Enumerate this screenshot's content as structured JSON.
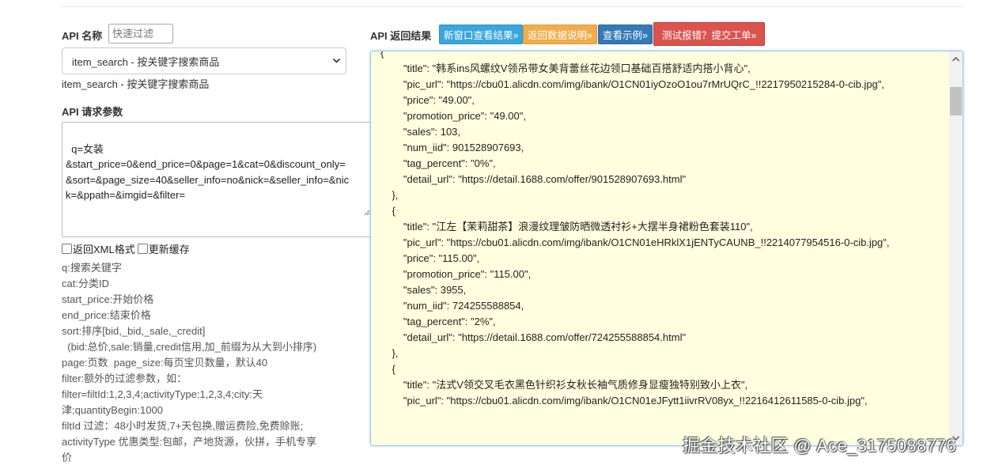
{
  "left": {
    "api_name_label": "API 名称",
    "filter_placeholder": "快速过滤",
    "selected_api": "item_search - 按关键字搜索商品",
    "selected_api_desc": "item_search - 按关键字搜索商品",
    "params_label": "API 请求参数",
    "params_text": "q=女装\n&start_price=0&end_price=0&page=1&cat=0&discount_only=\n&sort=&page_size=40&seller_info=no&nick=&seller_info=&nic\nk=&ppath=&imgid=&filter=",
    "checkbox_xml": "返回XML格式",
    "checkbox_cache": "更新缓存",
    "help_text": "q:搜索关键字\ncat:分类ID\nstart_price:开始价格\nend_price:结束价格\nsort:排序[bid,_bid,_sale,_credit]\n  (bid:总价,sale:销量,credit信用,加_前缀为从大到小排序)\npage:页数  page_size:每页宝贝数量，默认40\nfilter:额外的过滤参数，如：\nfilter=filtId:1,2,3,4;activityType:1,2,3,4;city:天\n津;quantityBegin:1000\nfiltId 过滤：48小时发货,7+天包换,赠运费险,免费赊账;\nactivityType 优惠类型:包邮，产地货源，伙拼，手机专享\n价"
  },
  "right": {
    "result_label": "API 返回结果",
    "btn_new_window": "新窗口查看结果»",
    "btn_data_desc": "返回数据说明»",
    "btn_example": "查看示例»",
    "btn_report": "测试报错？提交工单»",
    "result_text": "{\n        \"title\": \"韩系ins风螺纹V领吊带女美背蕾丝花边领口基础百搭舒适内搭小背心\",\n        \"pic_url\": \"https://cbu01.alicdn.com/img/ibank/O1CN01iyOzoO1ou7rMrUQrC_!!2217950215284-0-cib.jpg\",\n        \"price\": \"49.00\",\n        \"promotion_price\": \"49.00\",\n        \"sales\": 103,\n        \"num_iid\": 901528907693,\n        \"tag_percent\": \"0%\",\n        \"detail_url\": \"https://detail.1688.com/offer/901528907693.html\"\n    },\n    {\n        \"title\": \"江左【茉莉甜茶】浪漫纹理皱防晒微透衬衫+大摆半身裙粉色套装110\",\n        \"pic_url\": \"https://cbu01.alicdn.com/img/ibank/O1CN01eHRklX1jENTyCAUNB_!!2214077954516-0-cib.jpg\",\n        \"price\": \"115.00\",\n        \"promotion_price\": \"115.00\",\n        \"sales\": 3955,\n        \"num_iid\": 724255588854,\n        \"tag_percent\": \"2%\",\n        \"detail_url\": \"https://detail.1688.com/offer/724255588854.html\"\n    },\n    {\n        \"title\": \"法式V领交叉毛衣黑色针织衫女秋长袖气质修身显瘦独特别致小上衣\",\n        \"pic_url\": \"https://cbu01.alicdn.com/img/ibank/O1CN01eJFytt1iivrRV08yx_!!2216412611585-0-cib.jpg\","
  },
  "watermark": "掘金技术社区 @ Ace_3175088776",
  "colors": {
    "result_bg": "#ffffe0",
    "btn_blue": "#3aa6dc",
    "btn_orange": "#f0ad4e",
    "btn_navy": "#337ab7",
    "btn_red": "#d9534f"
  },
  "icons": [
    "chevron-down-icon",
    "resize-grip-icon",
    "scroll-up-icon",
    "scroll-down-icon"
  ]
}
